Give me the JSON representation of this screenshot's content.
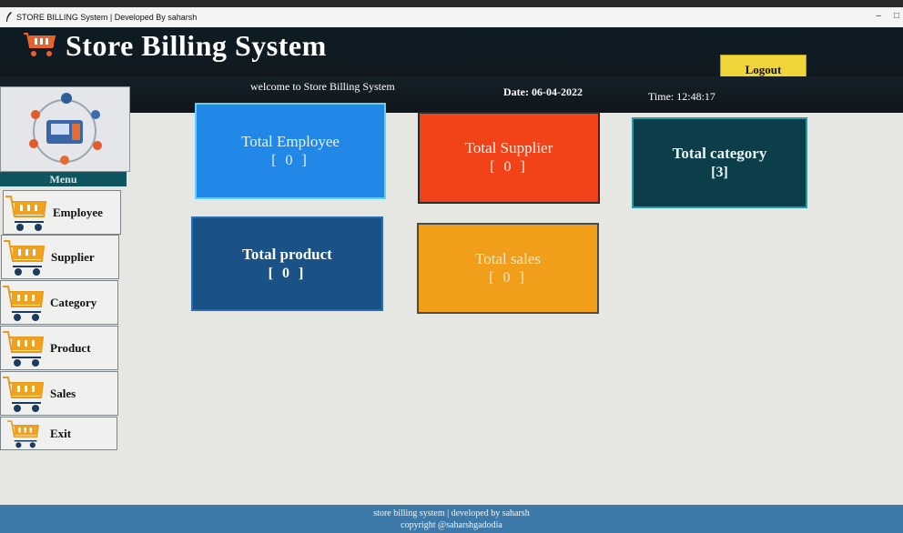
{
  "window": {
    "title": "STORE BILLING System | Developed By saharsh"
  },
  "header": {
    "app_title": "Store Billing System",
    "logout_label": "Logout"
  },
  "infobar": {
    "welcome": "welcome to Store Billing System",
    "date": "Date: 06-04-2022",
    "time": "Time: 12:48:17"
  },
  "sidebar": {
    "menu_label": "Menu",
    "items": [
      {
        "label": "Employee"
      },
      {
        "label": "Supplier"
      },
      {
        "label": "Category"
      },
      {
        "label": "Product"
      },
      {
        "label": "Sales"
      },
      {
        "label": "Exit"
      }
    ]
  },
  "cards": {
    "employee": {
      "title": "Total Employee",
      "value": "[ 0 ]"
    },
    "supplier": {
      "title": "Total Supplier",
      "value": "[ 0 ]"
    },
    "category": {
      "title": "Total category",
      "value": "[3]"
    },
    "product": {
      "title": "Total product",
      "value": "[ 0 ]"
    },
    "sales": {
      "title": "Total sales",
      "value": "[ 0 ]"
    }
  },
  "footer": {
    "line1": "store billing system | developed by saharsh",
    "line2": "copyright @saharshgadodia"
  },
  "colors": {
    "employee": "#2288e8",
    "supplier": "#f24218",
    "category": "#0b3e48",
    "product": "#1a5288",
    "sales": "#f19e1b",
    "logout": "#efd53a",
    "footer": "#3d7aa9"
  }
}
